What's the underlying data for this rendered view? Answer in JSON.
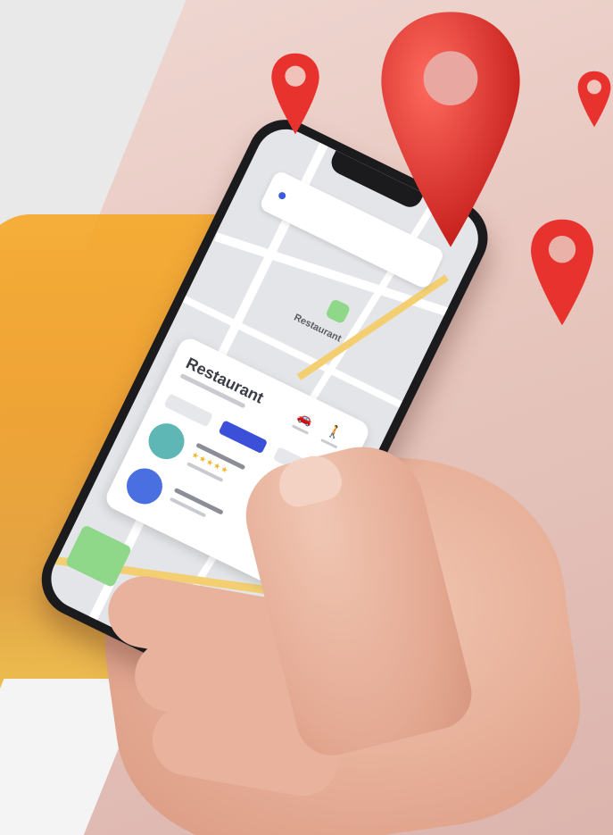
{
  "colors": {
    "background": "#e8c8c0",
    "accent_yellow": "#f6a92a",
    "pin_red": "#e8322e",
    "route_yellow": "#f3cf72",
    "park_green": "#8fd88a",
    "chip_active": "#3b4fd8",
    "avatar_teal": "#5fb7b5",
    "avatar_blue": "#4a6fe0"
  },
  "icons": [
    "location-pin-icon",
    "car-icon",
    "walk-icon",
    "star-icon"
  ],
  "phone": {
    "map_label": "Restaurant",
    "sheet": {
      "title": "Restaurant",
      "rating_stars": "★★★★★"
    }
  }
}
